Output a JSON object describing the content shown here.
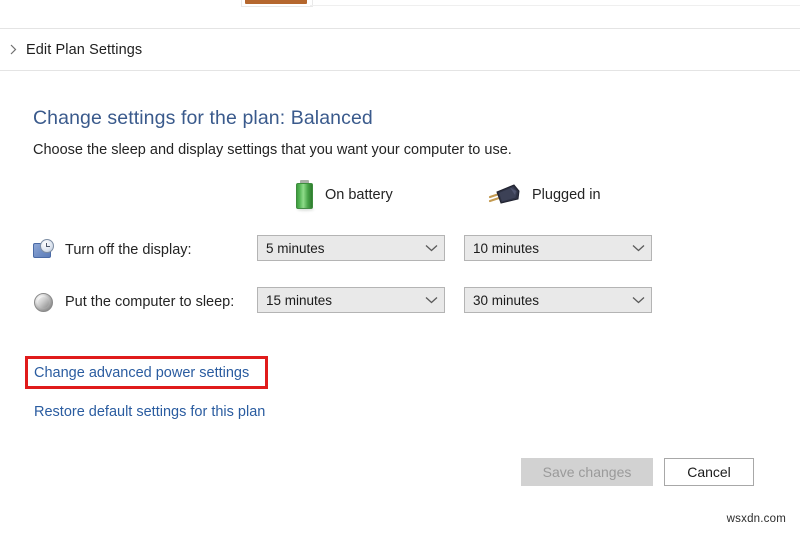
{
  "window": {
    "top_strip_accent_color": "#b5672e"
  },
  "breadcrumb": {
    "chevron_icon": "chevron-right-icon",
    "label": "Edit Plan Settings"
  },
  "main": {
    "title": "Change settings for the plan: Balanced",
    "title_color": "#3a5a8c",
    "subtitle": "Choose the sleep and display settings that you want your computer to use.",
    "columns": [
      {
        "icon": "battery-icon",
        "label": "On battery"
      },
      {
        "icon": "power-plug-icon",
        "label": "Plugged in"
      }
    ],
    "rows": [
      {
        "icon": "display-clock-icon",
        "label": "Turn off the display:",
        "on_battery": "5 minutes",
        "plugged_in": "10 minutes"
      },
      {
        "icon": "sleep-sphere-icon",
        "label": "Put the computer to sleep:",
        "on_battery": "15 minutes",
        "plugged_in": "30 minutes"
      }
    ],
    "dropdown_arrow_icon": "chevron-down-icon",
    "links": [
      {
        "label": "Change advanced power settings",
        "highlighted": true
      },
      {
        "label": "Restore default settings for this plan",
        "highlighted": false
      }
    ],
    "link_color": "#2a5ca0",
    "annotation_color": "#e01b1b"
  },
  "footer": {
    "save_label": "Save changes",
    "save_enabled": false,
    "cancel_label": "Cancel"
  },
  "watermark": {
    "text": "wsxdn.com"
  }
}
